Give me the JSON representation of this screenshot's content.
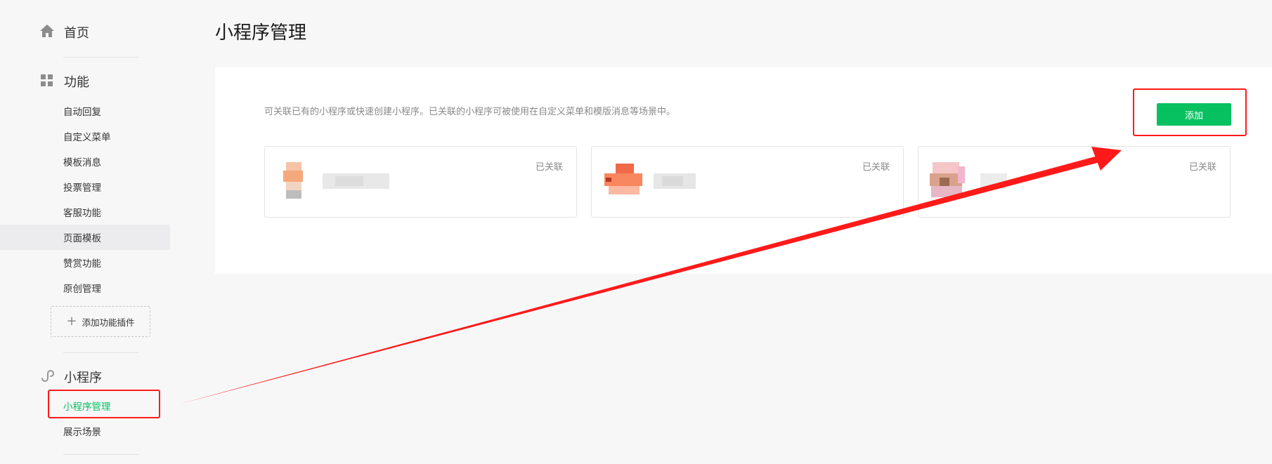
{
  "sidebar": {
    "home": {
      "label": "首页",
      "icon": "home-icon"
    },
    "features": {
      "label": "功能",
      "icon": "grid-icon",
      "items": [
        {
          "label": "自动回复"
        },
        {
          "label": "自定义菜单"
        },
        {
          "label": "模板消息"
        },
        {
          "label": "投票管理"
        },
        {
          "label": "客服功能"
        },
        {
          "label": "页面模板"
        },
        {
          "label": "赞赏功能"
        },
        {
          "label": "原创管理"
        }
      ],
      "add_plugin_label": "添加功能插件"
    },
    "miniprogram": {
      "label": "小程序",
      "icon": "miniprogram-icon",
      "items": [
        {
          "label": "小程序管理"
        },
        {
          "label": "展示场景"
        }
      ]
    }
  },
  "main": {
    "title": "小程序管理",
    "description": "可关联已有的小程序或快速创建小程序。已关联的小程序可被使用在自定义菜单和模版消息等场景中。",
    "add_button_label": "添加",
    "cards": [
      {
        "status": "已关联"
      },
      {
        "status": "已关联"
      },
      {
        "status": "已关联"
      }
    ]
  },
  "colors": {
    "accent_green": "#07c160",
    "annotation_red": "#ff1a1a",
    "background": "#f7f7f8"
  }
}
